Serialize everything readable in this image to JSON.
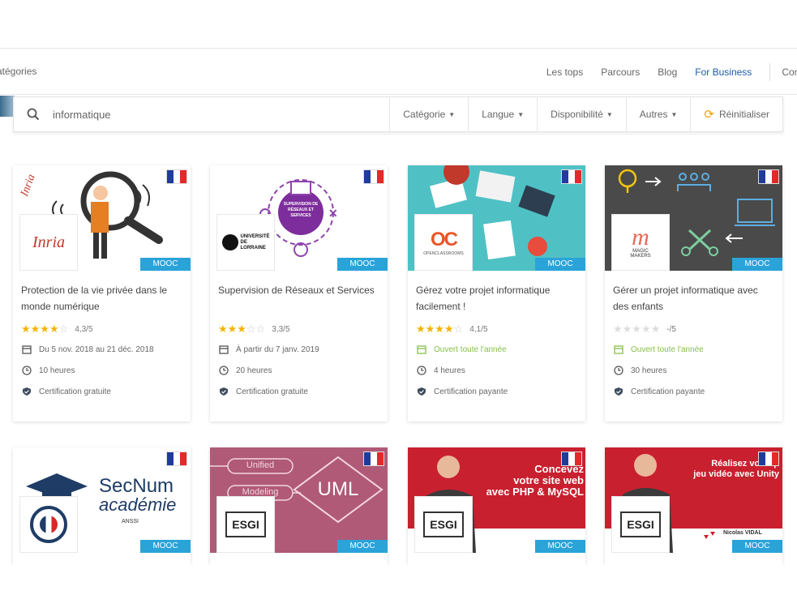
{
  "nav": {
    "categories": "atégories",
    "links": [
      "Les tops",
      "Parcours",
      "Blog",
      "For Business"
    ],
    "connect": "Conn"
  },
  "search": {
    "query": "informatique",
    "filters": [
      "Catégorie",
      "Langue",
      "Disponibilité",
      "Autres"
    ],
    "reset": "Réinitialiser"
  },
  "badge": "MOOC",
  "cards": [
    {
      "title": "Protection de la vie privée dans le monde numérique",
      "rating": "4,3/5",
      "stars": 4,
      "date": "Du 5 nov. 2018 au 21 déc. 2018",
      "duration": "10 heures",
      "certification": "Certification gratuite",
      "logo_text": "Inria"
    },
    {
      "title": "Supervision de Réseaux et Services",
      "rating": "3,3/5",
      "stars": 3,
      "date": "À partir du 7 janv. 2019",
      "duration": "20 heures",
      "certification": "Certification gratuite",
      "logo_text": "UNIVERSITÉ DE LORRAINE",
      "image_text": "SUPERVISION DE RÉSEAUX ET SERVICES"
    },
    {
      "title": "Gérez votre projet informatique facilement !",
      "rating": "4,1/5",
      "stars": 4,
      "date": "Ouvert toute l'année",
      "duration": "4 heures",
      "certification": "Certification payante",
      "logo_text": "OC",
      "logo_sub": "OPENCLASSROOMS"
    },
    {
      "title": "Gérer un projet informatique avec des enfants",
      "rating": "-/5",
      "stars": 0,
      "date": "Ouvert toute l'année",
      "duration": "30 heures",
      "certification": "Certification payante",
      "logo_text": "MAGIC MAKERS"
    },
    {
      "image_title": "SecNum",
      "image_sub": "académie",
      "image_small": "ANSSI"
    },
    {
      "image_items": [
        "Unified",
        "Modeling"
      ],
      "image_big": "UML",
      "logo_text": "ESGI"
    },
    {
      "image_lines": [
        "Concevez",
        "votre site web",
        "avec PHP & MySQL"
      ],
      "logo_text": "ESGI"
    },
    {
      "image_lines": [
        "Réalisez votre p",
        "jeu vidéo avec Unity"
      ],
      "logo_text": "ESGI",
      "image_name": "Nicolas VIDAL"
    }
  ]
}
